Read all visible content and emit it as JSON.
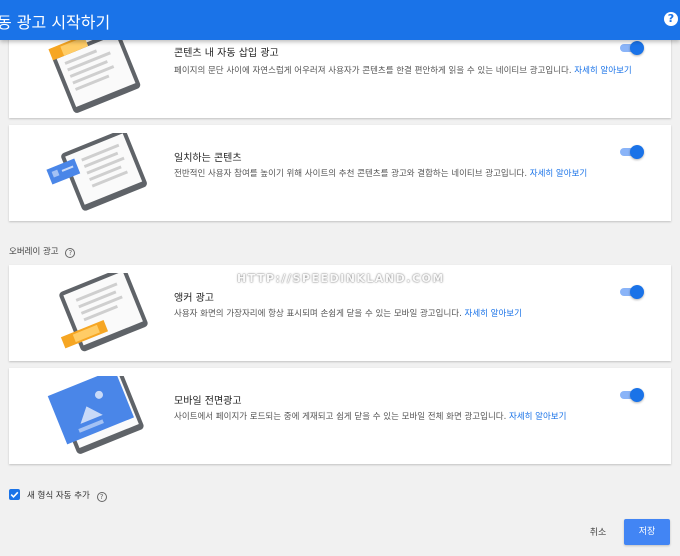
{
  "header": {
    "title": "동 광고 시작하기",
    "help_icon": "?"
  },
  "cards": [
    {
      "title": "콘텐츠 내 자동 삽입 광고",
      "desc": "페이지의 문단 사이에 자연스럽게 어우러져 사용자가 콘텐츠를 한결 편안하게 읽을 수 있는 네이티브 광고입니다.",
      "link": "자세히 알아보기",
      "enabled": true
    },
    {
      "title": "일치하는 콘텐츠",
      "desc": "전반적인 사용자 참여를 높이기 위해 사이트의 추천 콘텐츠를 광고와 결합하는 네이티브 광고입니다.",
      "link": "자세히 알아보기",
      "enabled": true
    },
    {
      "title": "앵커 광고",
      "desc": "사용자 화면의 가장자리에 항상 표시되며 손쉽게 닫을 수 있는 모바일 광고입니다.",
      "link": "자세히 알아보기",
      "enabled": true
    },
    {
      "title": "모바일 전면광고",
      "desc": "사이트에서 페이지가 로드되는 중에 게재되고 쉽게 닫을 수 있는 모바일 전체 화면 광고입니다.",
      "link": "자세히 알아보기",
      "enabled": true
    }
  ],
  "overlay_section": {
    "label": "오버레이 광고",
    "help": "?"
  },
  "watermark": "HTTP://SPEEDINKLAND.COM",
  "auto_add": {
    "label": "새 형식 자동 추가",
    "checked": true,
    "help": "?"
  },
  "footer": {
    "cancel": "취소",
    "save": "저장"
  },
  "colors": {
    "accent": "#1a73e8",
    "illustration_orange": "#f6a623",
    "illustration_blue": "#4a86e8"
  }
}
